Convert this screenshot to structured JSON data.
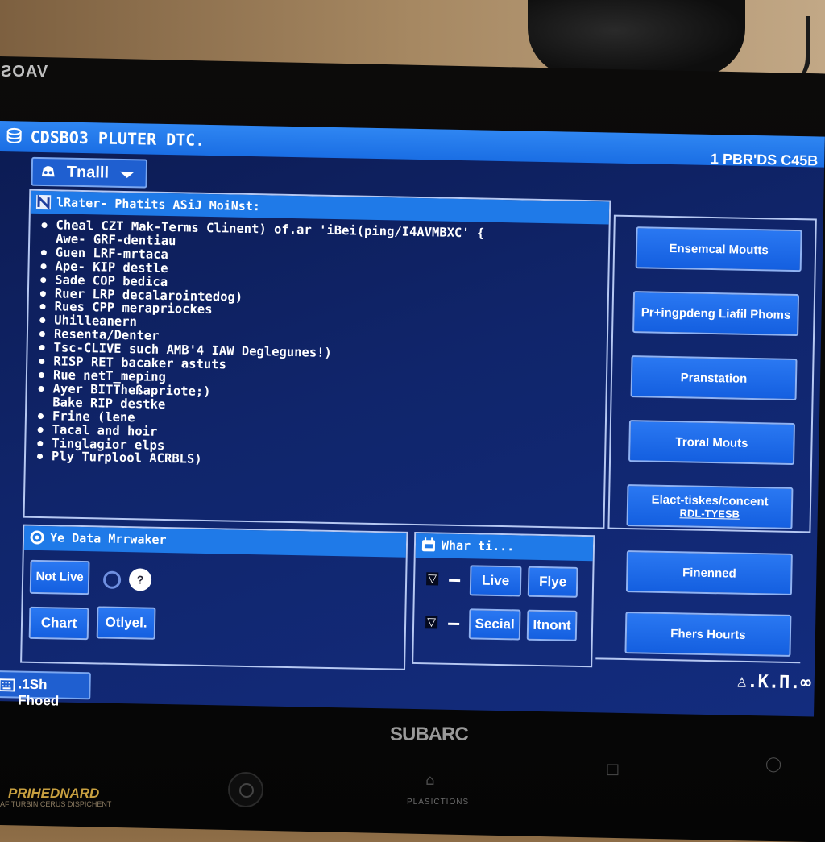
{
  "monitor": {
    "top_brand": "VAOS",
    "bottom_brand": "SUBARC",
    "sub_brand": "PRIHEDNARD",
    "sub_brand_tagline": "AF TURBIN CERUS DISPICHENT",
    "control_label": "PLASICTIONS"
  },
  "titlebar": {
    "app_title": "CDSBO3 PLUTER DTC.",
    "right_text": "1 PBR'DS C45B"
  },
  "dropdown": {
    "label": "Tnalll",
    "icon": "car-icon"
  },
  "main_panel": {
    "title": "lRater- Phatits ASiJ MoiNst:",
    "items": [
      {
        "text": "Cheal CZT Mak-Terms Clinent) of.ar 'iBei(ping/I4AVMBXC' {",
        "bullet": true
      },
      {
        "text": "Awe- GRF-dentiau",
        "bullet": false
      },
      {
        "text": "Guen LRF-mrtaca",
        "bullet": true
      },
      {
        "text": "Ape- KIP destle",
        "bullet": true
      },
      {
        "text": "Sade COP bedica",
        "bullet": true
      },
      {
        "text": "Ruer LRP decalarointedog)",
        "bullet": true
      },
      {
        "text": "Rues CPP merapriockes",
        "bullet": true
      },
      {
        "text": "Uhilleanern",
        "bullet": true
      },
      {
        "text": "Resenta/Denter",
        "bullet": true
      },
      {
        "text": " Tsc-CLIVE such AMB'4 IAW Deglegunes!)",
        "bullet": true
      },
      {
        "text": "RISP RET bacaker astuts",
        "bullet": true
      },
      {
        "text": "Rue netT_meping",
        "bullet": true
      },
      {
        "text": "Ayer BITTheßapriote;)",
        "bullet": true
      },
      {
        "text": "Bake RIP destke",
        "bullet": false
      },
      {
        "text": "Frine (lene",
        "bullet": true
      },
      {
        "text": "Tacal and hoir",
        "bullet": true
      },
      {
        "text": "Tinglagior elps",
        "bullet": true
      },
      {
        "text": "Ply Turplool ACRBLS)",
        "bullet": true
      }
    ]
  },
  "side_buttons": [
    {
      "label": "Ensemcal Moutts"
    },
    {
      "label": "Pr+ingpdeng Liafil Phoms"
    },
    {
      "label": "Pranstation"
    },
    {
      "label": "Troral Mouts"
    },
    {
      "label": "Elact-tiskes/concent",
      "sublabel": "RDL-TYESB"
    }
  ],
  "data_panel": {
    "title": "Ye Data Mrrwaker",
    "not_live_label": "Not Live",
    "help_label": "?",
    "chart_label": "Chart",
    "other_label": "Otlyel."
  },
  "what_panel": {
    "title": "Whar ti...",
    "rows": [
      {
        "marker": "▽",
        "buttons": [
          "Live",
          "Flye"
        ]
      },
      {
        "marker": "▽",
        "buttons": [
          "Secial",
          "Itnont"
        ]
      }
    ]
  },
  "lower_right_buttons": [
    {
      "label": "Finenned"
    },
    {
      "label": "Fhers Hourts"
    }
  ],
  "status_bar": {
    "left_label": ".1Sh Fhoed",
    "right_text": "♙.K.П.∞"
  },
  "colors": {
    "titlebar": "#1f7ae8",
    "screen_bg": "#10256b",
    "button": "#1f68e8",
    "border": "#b6c8f2"
  }
}
